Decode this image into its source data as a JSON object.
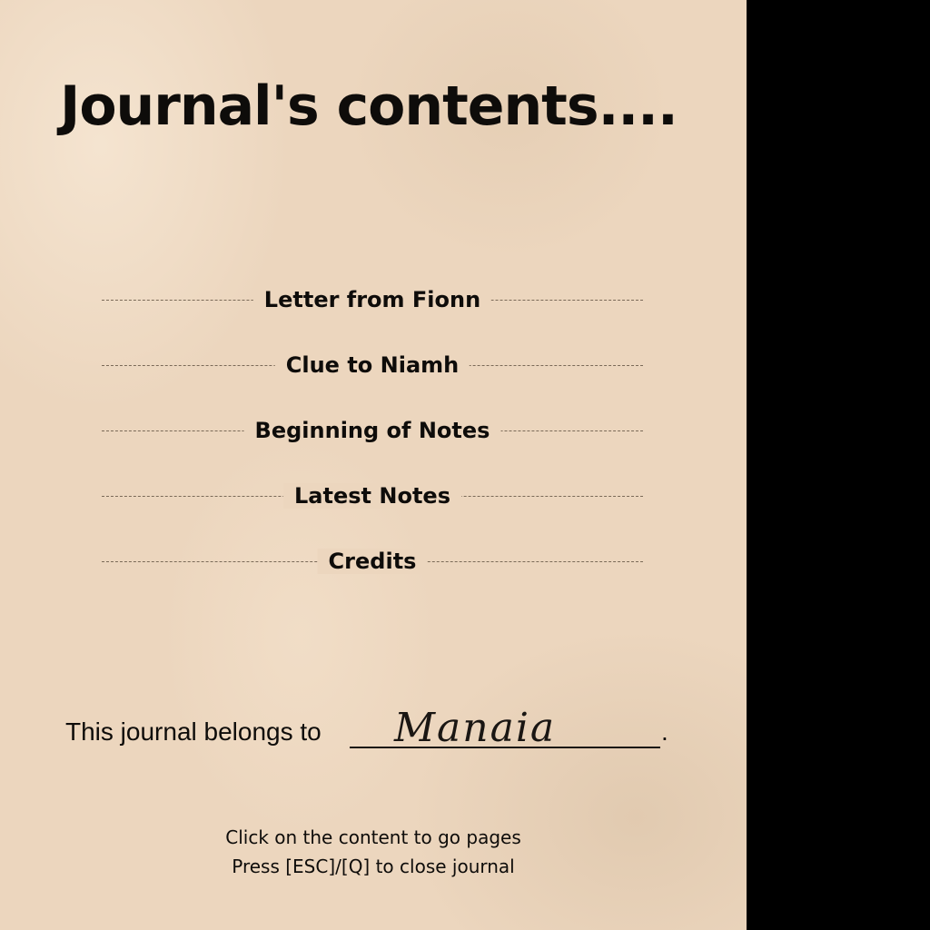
{
  "journal": {
    "title": "Journal's contents....",
    "contents": [
      {
        "label": "Letter from Fionn"
      },
      {
        "label": "Clue to Niamh"
      },
      {
        "label": "Beginning of Notes"
      },
      {
        "label": "Latest Notes"
      },
      {
        "label": "Credits"
      }
    ],
    "owner": {
      "prefix": "This journal belongs to",
      "name": "Manaia",
      "suffix": "."
    },
    "hints": [
      "Click on the content to go pages",
      "Press [ESC]/[Q] to close journal"
    ]
  },
  "colors": {
    "paper": "#ecd6be",
    "ink": "#0e0c0a",
    "background": "#000000"
  }
}
